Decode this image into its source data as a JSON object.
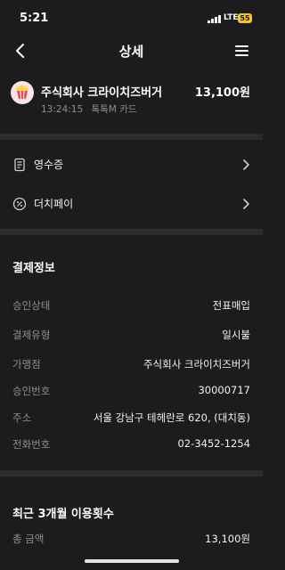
{
  "status_bar": {
    "time": "5:21",
    "network": "LTE",
    "battery": "55"
  },
  "nav": {
    "title": "상세"
  },
  "merchant": {
    "name": "주식회사 크라이치즈버거",
    "amount": "13,100원",
    "time": "13:24:15",
    "card": "톡톡M 카드",
    "logo_color": "#e94b5c"
  },
  "links": [
    {
      "label": "영수증",
      "icon": "receipt-icon"
    },
    {
      "label": "더치페이",
      "icon": "dutch-pay-icon"
    }
  ],
  "payment_info": {
    "title": "결제정보",
    "rows": [
      {
        "key": "승인상태",
        "value": "전표매입"
      },
      {
        "key": "결제유형",
        "value": "일시불"
      },
      {
        "key": "가맹점",
        "value": "주식회사 크라이치즈버거"
      },
      {
        "key": "승인번호",
        "value": "30000717"
      },
      {
        "key": "주소",
        "value": "서울 강남구 테헤란로 620, (대치동)"
      },
      {
        "key": "전화번호",
        "value": "02-3452-1254"
      }
    ]
  },
  "usage": {
    "title": "최근 3개월 이용횟수",
    "rows": [
      {
        "key": "총 금액",
        "value": "13,100원"
      }
    ]
  },
  "colors": {
    "background": "#1c1c1e",
    "separator": "#2c2c2e",
    "muted": "#8e8e93",
    "battery": "#f5c518"
  }
}
